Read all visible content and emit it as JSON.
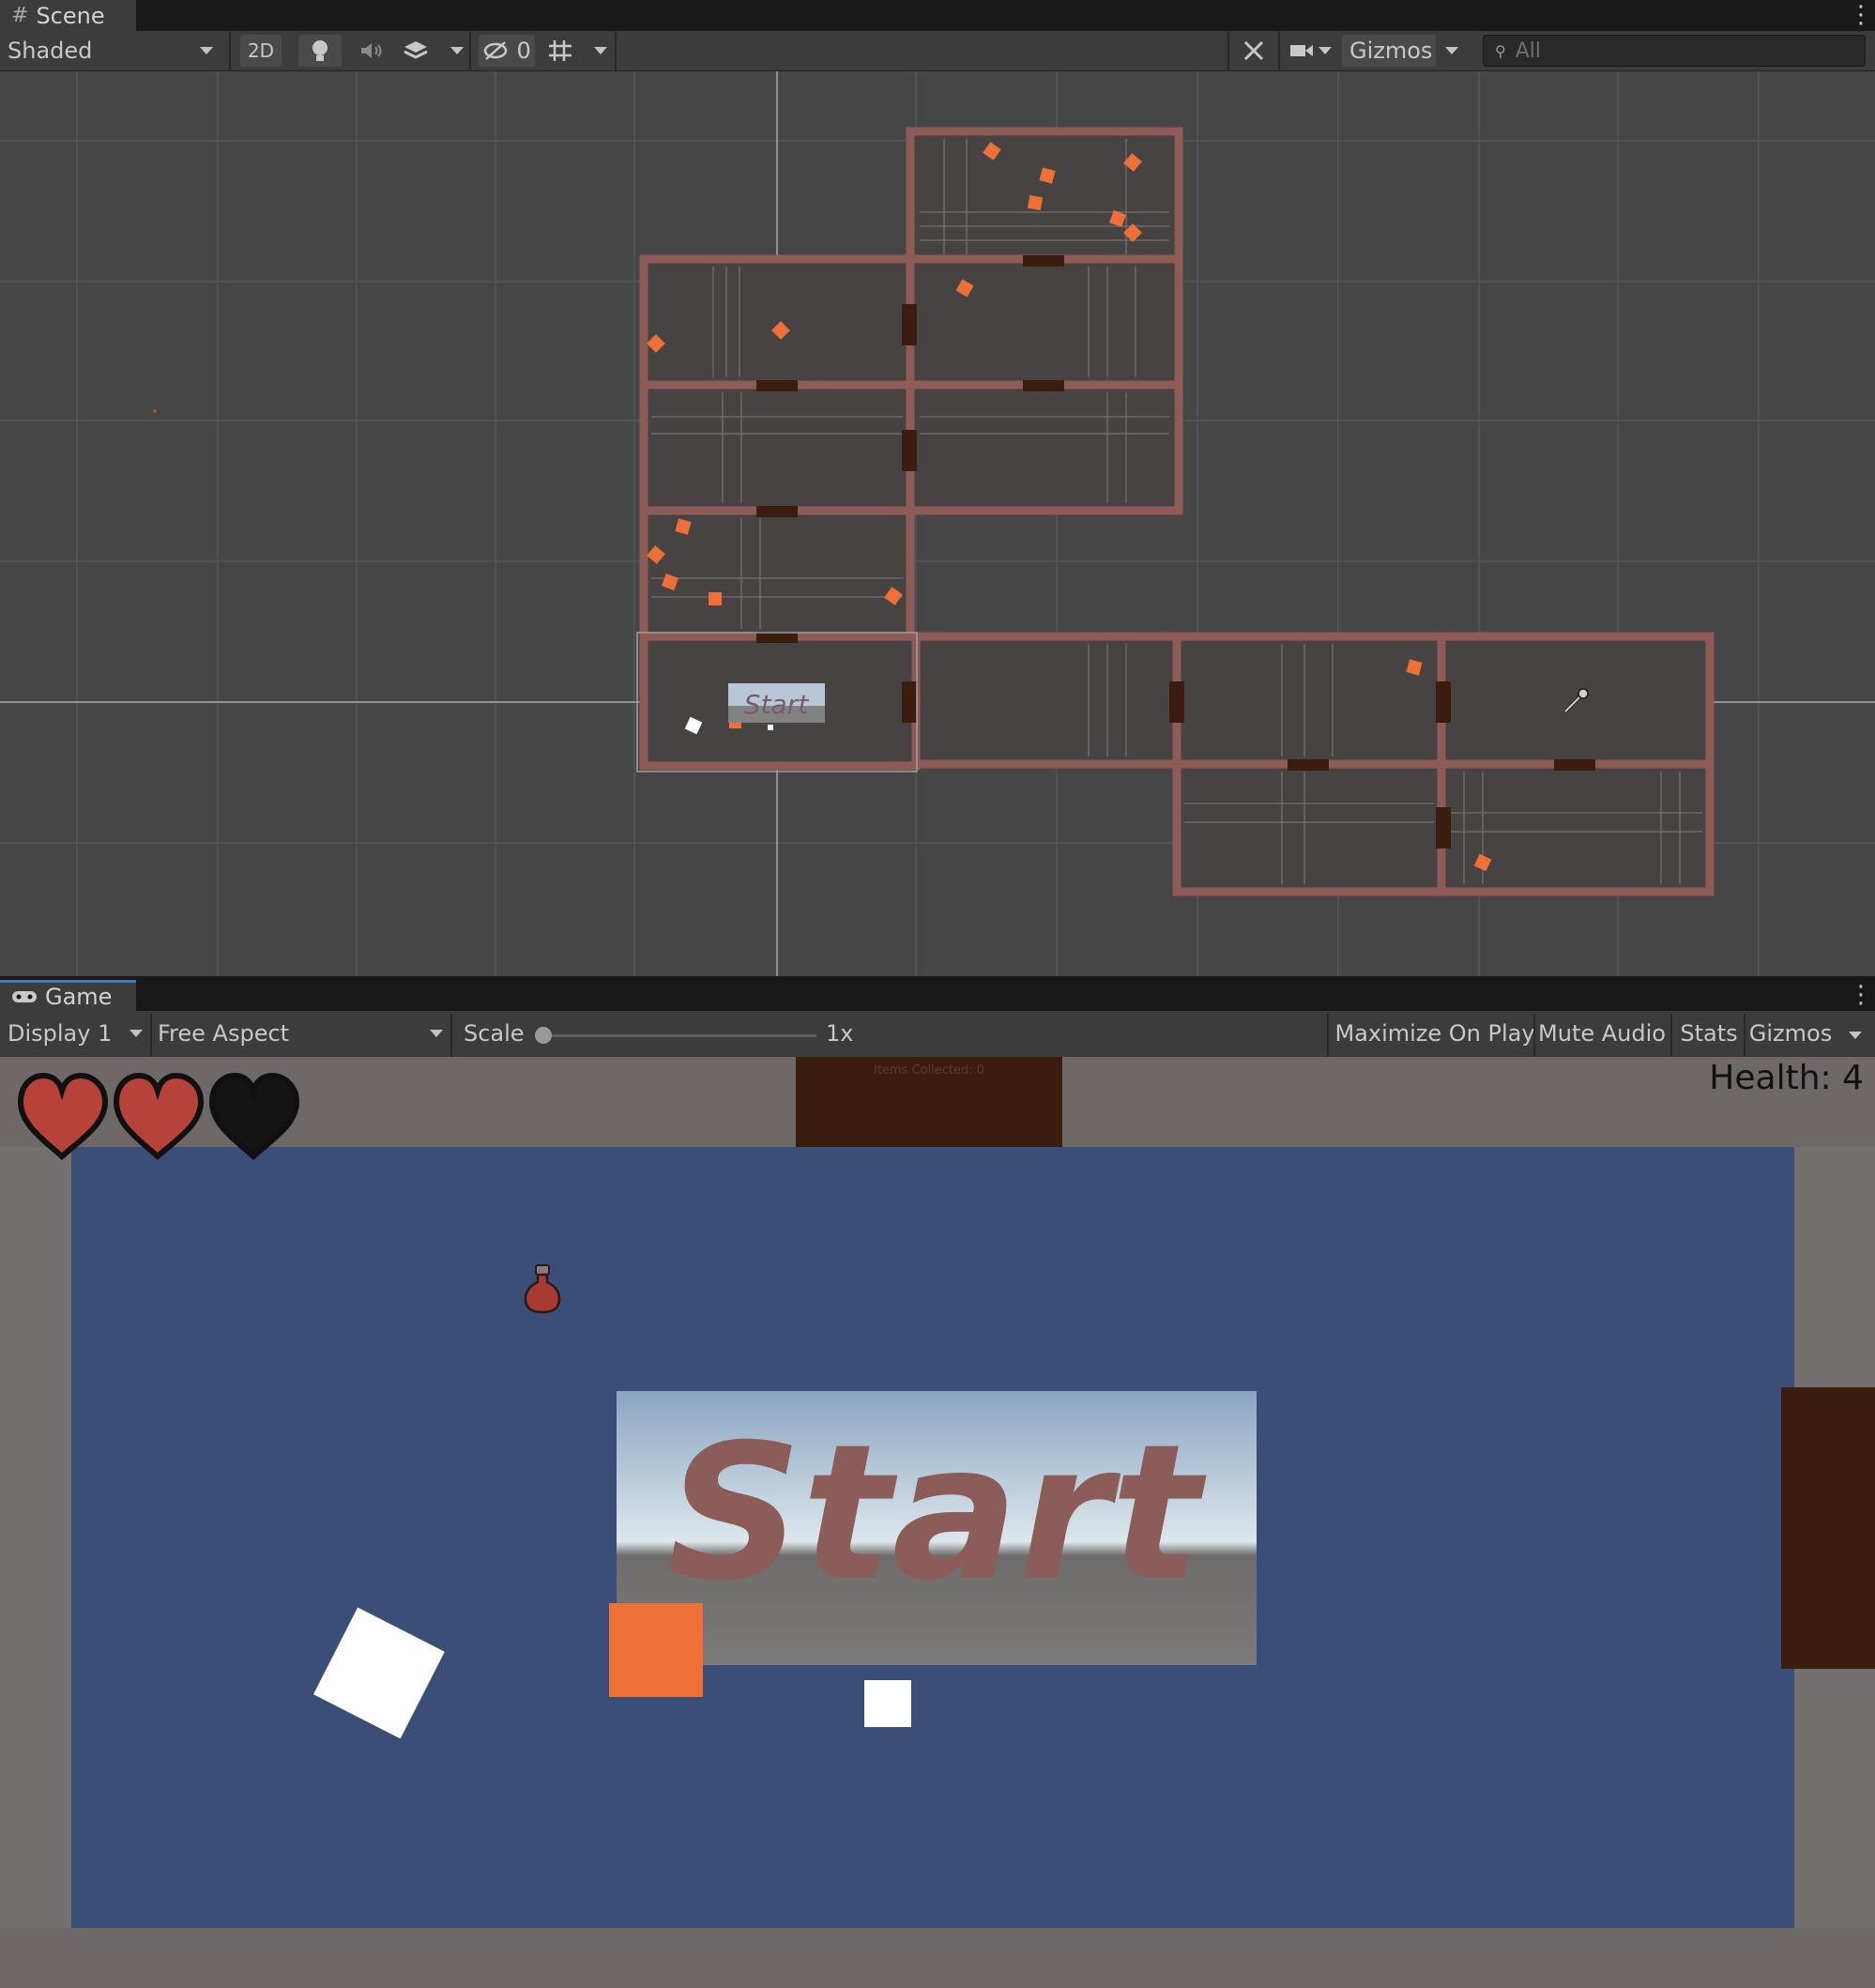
{
  "scene_panel": {
    "tab_label": "Scene",
    "shading_mode": "Shaded",
    "mode_2d": "2D",
    "hidden_count": "0",
    "gizmos_label": "Gizmos",
    "search_placeholder": "All",
    "start_sign_text": "Start"
  },
  "game_panel": {
    "tab_label": "Game",
    "display": "Display 1",
    "aspect": "Free Aspect",
    "scale_label": "Scale",
    "scale_value": "1x",
    "maximize_on_play": "Maximize On Play",
    "mute_audio": "Mute Audio",
    "stats": "Stats",
    "gizmos": "Gizmos"
  },
  "hud": {
    "health_text": "Health: 4",
    "items_collected_text": "Items Collected: 0",
    "hearts": [
      "full",
      "full",
      "empty"
    ]
  },
  "world": {
    "start_sign_text": "Start"
  },
  "colors": {
    "accent_orange": "#ee6f38",
    "room_floor_blue": "#3a4e78",
    "wall_color": "#746e6e",
    "door_color": "#3b1d0f",
    "heart_full": "#b6423a",
    "heart_empty": "#141414"
  }
}
